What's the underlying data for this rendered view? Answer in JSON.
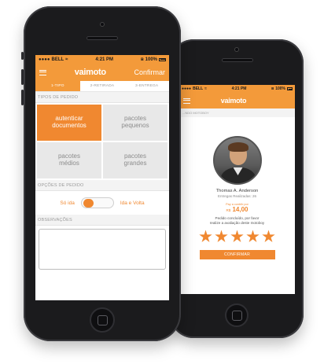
{
  "front": {
    "status": {
      "carrier": "BELL",
      "time": "4:21 PM",
      "battery": "100%"
    },
    "nav": {
      "logo": "vaimoto",
      "action": "Confirmar"
    },
    "steps": [
      {
        "label": "1-TIPO",
        "active": true
      },
      {
        "label": "2-RETIRADA",
        "active": false
      },
      {
        "label": "3-ENTREGA",
        "active": false
      }
    ],
    "order_types": {
      "title": "TIPOS DE PEDIDO",
      "tiles": [
        {
          "line1": "autenticar",
          "line2": "documentos",
          "selected": true
        },
        {
          "line1": "pacotes",
          "line2": "pequenos",
          "selected": false
        },
        {
          "line1": "pacotes",
          "line2": "médios",
          "selected": false
        },
        {
          "line1": "pacotes",
          "line2": "grandes",
          "selected": false
        }
      ]
    },
    "order_options": {
      "title": "OPÇÕES DE PEDIDO",
      "option_left": "Só ida",
      "option_right": "Ida e Volta"
    },
    "observations": {
      "title": "OBSERVAÇÕES"
    }
  },
  "back": {
    "status": {
      "carrier": "BELL",
      "time": "4:21 PM",
      "battery": "100%"
    },
    "nav": {
      "logo": "vaimoto"
    },
    "breadcrumb": "...NDO MOTOBOY",
    "courier": {
      "name": "Thomas A. Anderson",
      "deliveries": "Entregas Realizadas: 26"
    },
    "payment": {
      "label": "Pay a contrib por",
      "currency": "R$",
      "amount": "14,00"
    },
    "message_line1": "Pedido concluído, por favor",
    "message_line2": "realize a avaliação deste motoboy",
    "rating": {
      "stars": 5,
      "max": 5
    },
    "confirm": "CONFIRMAR"
  },
  "colors": {
    "accent": "#f08830",
    "accent_light": "#f39a3a",
    "tile_bg": "#e8e8e8"
  }
}
